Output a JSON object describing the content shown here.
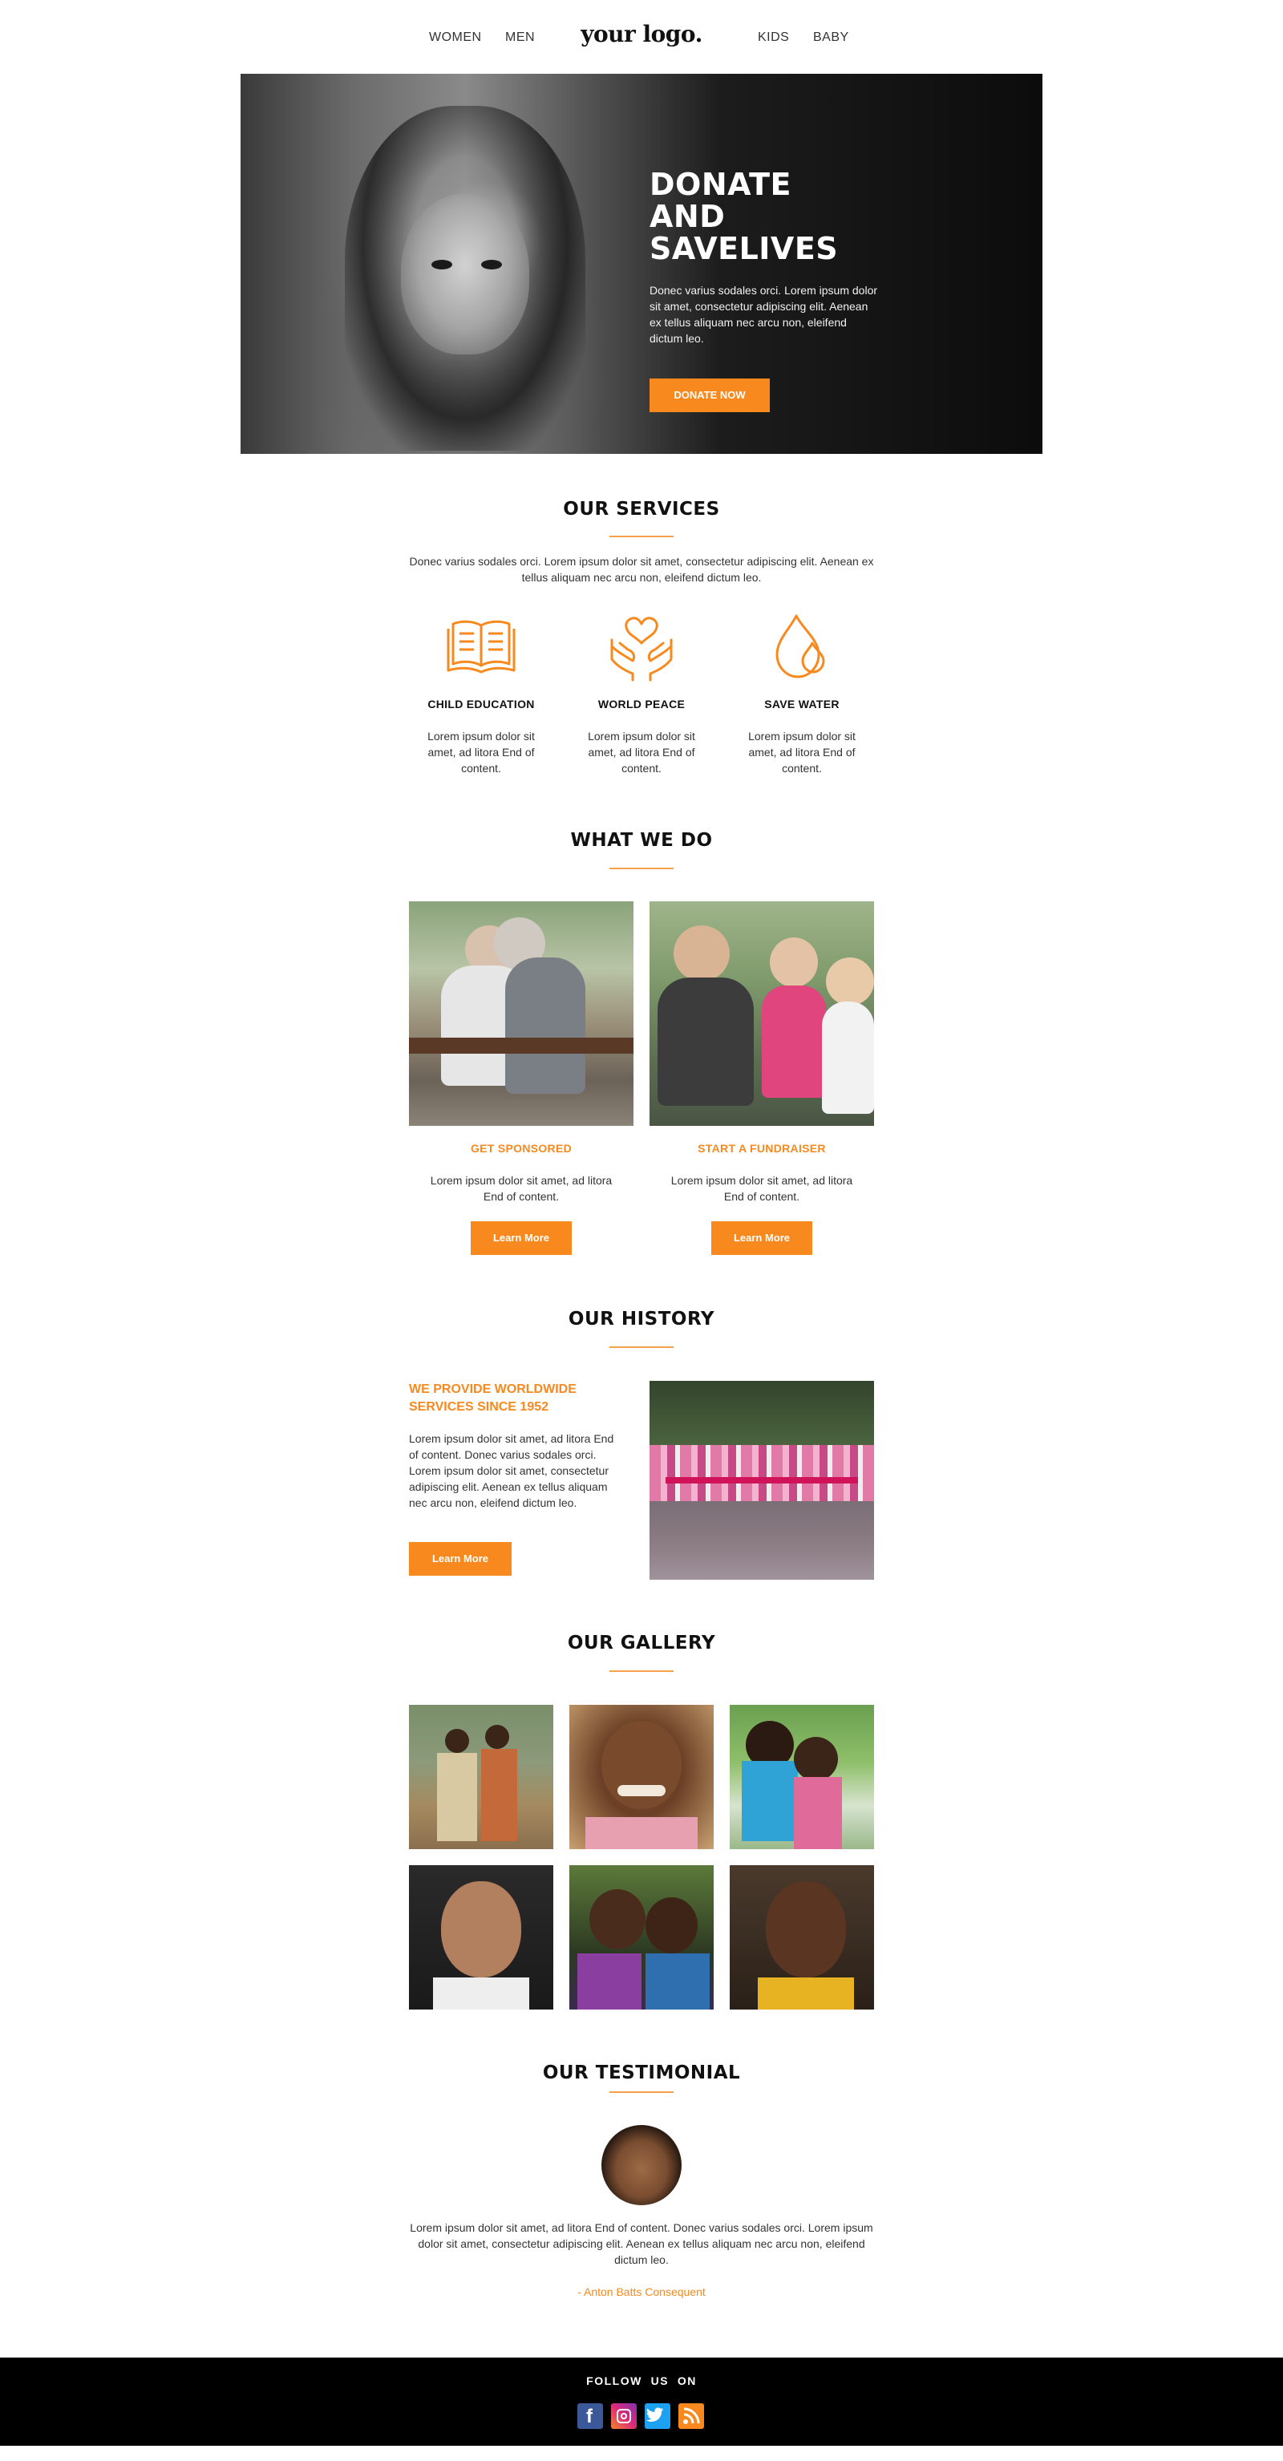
{
  "header": {
    "nav_left": [
      "WOMEN",
      "MEN"
    ],
    "logo": "your logo.",
    "nav_right": [
      "KIDS",
      "BABY"
    ]
  },
  "hero": {
    "title_lines": [
      "DONATE",
      "AND",
      "SAVELIVES"
    ],
    "text": "Donec varius sodales orci. Lorem ipsum dolor sit amet, consectetur adipiscing elit. Aenean ex tellus aliquam nec arcu non, eleifend dictum leo.",
    "button": "DONATE NOW"
  },
  "services": {
    "title": "OUR SERVICES",
    "intro": "Donec varius sodales orci. Lorem ipsum dolor sit amet, consectetur adipiscing elit. Aenean ex tellus aliquam nec arcu non, eleifend dictum leo.",
    "items": [
      {
        "icon": "book-icon",
        "title": "CHILD EDUCATION",
        "text": "Lorem ipsum dolor sit amet, ad litora End of content."
      },
      {
        "icon": "heart-hands-icon",
        "title": "WORLD PEACE",
        "text": "Lorem ipsum dolor sit amet, ad litora End of content."
      },
      {
        "icon": "water-drops-icon",
        "title": "SAVE WATER",
        "text": "Lorem ipsum dolor sit amet, ad litora End of content."
      }
    ]
  },
  "what_we_do": {
    "title": "WHAT WE DO",
    "items": [
      {
        "label": "GET SPONSORED",
        "text": "Lorem ipsum dolor sit amet, ad litora End of content.",
        "button": "Learn More"
      },
      {
        "label": "START A FUNDRAISER",
        "text": "Lorem ipsum dolor sit amet, ad litora End of content.",
        "button": "Learn More"
      }
    ]
  },
  "history": {
    "title": "OUR HISTORY",
    "heading": "WE PROVIDE WORLDWIDE SERVICES SINCE 1952",
    "text": "Lorem ipsum dolor sit amet, ad litora End of content. Donec varius sodales orci. Lorem ipsum dolor sit amet, consectetur adipiscing elit. Aenean ex tellus aliquam nec arcu non, eleifend dictum leo.",
    "button": "Learn More"
  },
  "gallery": {
    "title": "OUR GALLERY"
  },
  "testimonial": {
    "title": "OUR TESTIMONIAL",
    "text": "Lorem ipsum dolor sit amet, ad litora End of content. Donec varius sodales orci. Lorem ipsum dolor sit amet, consectetur adipiscing elit. Aenean ex tellus aliquam nec arcu non, eleifend dictum leo.",
    "author": "- Anton Batts Consequent"
  },
  "footer": {
    "follow": "FOLLOW  US  ON",
    "social": [
      {
        "icon": "facebook-icon",
        "color": "#3b5998",
        "glyph": "f"
      },
      {
        "icon": "instagram-icon",
        "color": "#d6249f",
        "glyph": "◎"
      },
      {
        "icon": "twitter-icon",
        "color": "#1da1f2",
        "glyph": "t"
      },
      {
        "icon": "rss-icon",
        "color": "#f7891e",
        "glyph": "))"
      }
    ]
  },
  "colors": {
    "accent": "#f7891e",
    "footer_bg": "#000000"
  }
}
